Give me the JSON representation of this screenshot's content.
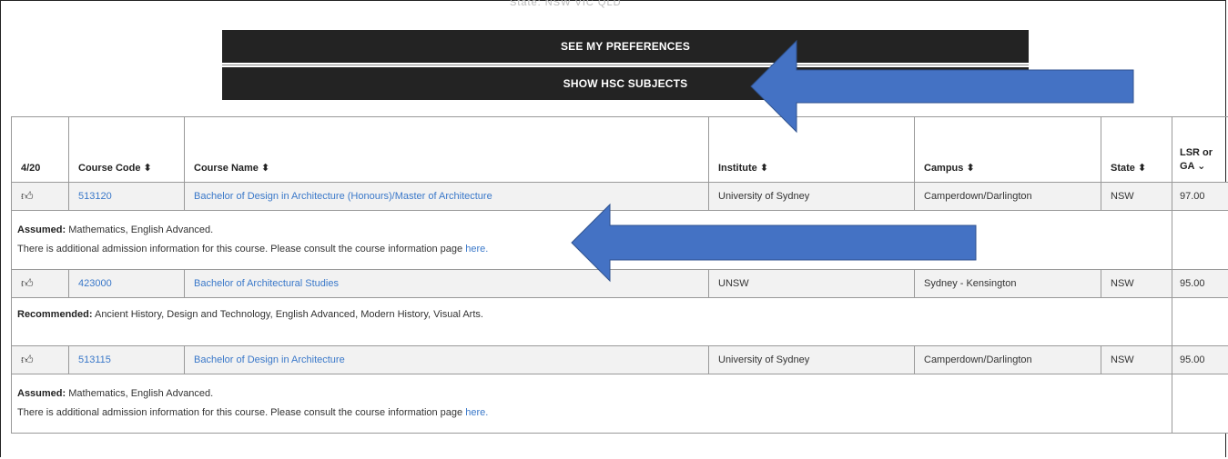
{
  "header": {
    "truncated_text": "State: NSW  VIC  QLD",
    "see_preferences_label": "SEE MY PREFERENCES",
    "show_hsc_label": "SHOW HSC SUBJECTS"
  },
  "table": {
    "headers": {
      "count": "4/20",
      "course_code": "Course Code ⬍",
      "course_name": "Course Name ⬍",
      "institute": "Institute ⬍",
      "campus": "Campus ⬍",
      "state": "State ⬍",
      "lsr_line1": "LSR or",
      "lsr_line2": "GA ⌄"
    },
    "rows": [
      {
        "icon": "thumbs-up-icon",
        "code": "513120",
        "name": "Bachelor of Design in Architecture (Honours)/Master of Architecture",
        "institute": "University of Sydney",
        "campus": "Camperdown/Darlington",
        "state": "NSW",
        "lsr": "97.00",
        "info_label": "Assumed:",
        "info_subjects": " Mathematics, English Advanced.",
        "info_note": "There is additional admission information for this course. Please consult the course information page ",
        "info_link": "here."
      },
      {
        "icon": "thumbs-up-icon",
        "code": "423000",
        "name": "Bachelor of Architectural Studies",
        "institute": "UNSW",
        "campus": "Sydney - Kensington",
        "state": "NSW",
        "lsr": "95.00",
        "info_label": "Recommended:",
        "info_subjects": " Ancient History, Design and Technology, English Advanced, Modern History, Visual Arts."
      },
      {
        "icon": "thumbs-up-icon",
        "code": "513115",
        "name": "Bachelor of Design in Architecture",
        "institute": "University of Sydney",
        "campus": "Camperdown/Darlington",
        "state": "NSW",
        "lsr": "95.00",
        "info_label": "Assumed:",
        "info_subjects": " Mathematics, English Advanced.",
        "info_note": "There is additional admission information for this course. Please consult the course information page ",
        "info_link": "here."
      }
    ]
  },
  "colors": {
    "arrow": "#4472c4",
    "button_bg": "#232323",
    "link": "#3a78c9"
  }
}
